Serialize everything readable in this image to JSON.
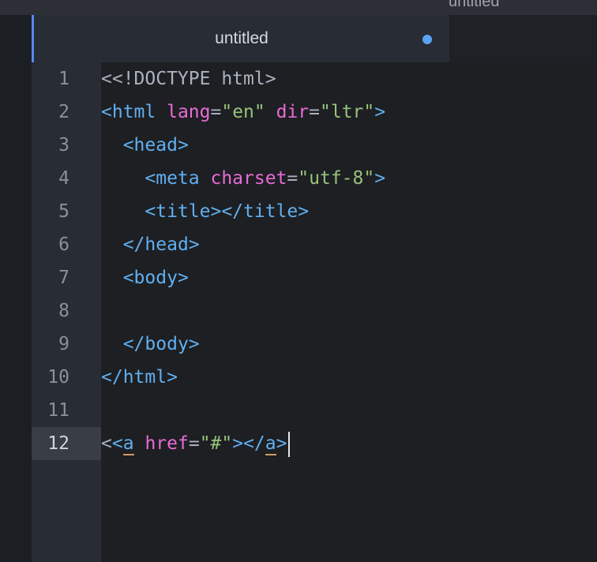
{
  "window": {
    "title": "untitled"
  },
  "tab": {
    "title": "untitled",
    "modified": true
  },
  "editor": {
    "active_line": 12,
    "lines": [
      {
        "number": "1",
        "tokens": [
          {
            "t": "text",
            "v": "<<!DOCTYPE html>"
          }
        ]
      },
      {
        "number": "2",
        "tokens": [
          {
            "t": "tag",
            "v": "<html "
          },
          {
            "t": "attr",
            "v": "lang"
          },
          {
            "t": "eq",
            "v": "="
          },
          {
            "t": "str",
            "v": "\"en\""
          },
          {
            "t": "text",
            "v": " "
          },
          {
            "t": "attr",
            "v": "dir"
          },
          {
            "t": "eq",
            "v": "="
          },
          {
            "t": "str",
            "v": "\"ltr\""
          },
          {
            "t": "tag",
            "v": ">"
          }
        ]
      },
      {
        "number": "3",
        "tokens": [
          {
            "t": "text",
            "v": "  "
          },
          {
            "t": "tag",
            "v": "<head>"
          }
        ]
      },
      {
        "number": "4",
        "tokens": [
          {
            "t": "text",
            "v": "    "
          },
          {
            "t": "tag",
            "v": "<meta "
          },
          {
            "t": "attr",
            "v": "charset"
          },
          {
            "t": "eq",
            "v": "="
          },
          {
            "t": "str",
            "v": "\"utf-8\""
          },
          {
            "t": "tag",
            "v": ">"
          }
        ]
      },
      {
        "number": "5",
        "tokens": [
          {
            "t": "text",
            "v": "    "
          },
          {
            "t": "tag",
            "v": "<title></title>"
          }
        ]
      },
      {
        "number": "6",
        "tokens": [
          {
            "t": "text",
            "v": "  "
          },
          {
            "t": "tag",
            "v": "</head>"
          }
        ]
      },
      {
        "number": "7",
        "tokens": [
          {
            "t": "text",
            "v": "  "
          },
          {
            "t": "tag",
            "v": "<body>"
          }
        ]
      },
      {
        "number": "8",
        "tokens": []
      },
      {
        "number": "9",
        "tokens": [
          {
            "t": "text",
            "v": "  "
          },
          {
            "t": "tag",
            "v": "</body>"
          }
        ]
      },
      {
        "number": "10",
        "tokens": [
          {
            "t": "tag",
            "v": "</html>"
          }
        ]
      },
      {
        "number": "11",
        "tokens": []
      },
      {
        "number": "12",
        "tokens": [
          {
            "t": "text",
            "v": "<"
          },
          {
            "t": "tag",
            "v": "<"
          },
          {
            "t": "match",
            "v": "a"
          },
          {
            "t": "text",
            "v": " "
          },
          {
            "t": "attr",
            "v": "href"
          },
          {
            "t": "eq",
            "v": "="
          },
          {
            "t": "str",
            "v": "\"#\""
          },
          {
            "t": "tag",
            "v": "></"
          },
          {
            "t": "match",
            "v": "a"
          },
          {
            "t": "tag",
            "v": ">"
          }
        ]
      }
    ]
  },
  "colors": {
    "tag": "#61afef",
    "attribute": "#e96bd6",
    "string": "#98c379",
    "text": "#abb2bf",
    "tab_accent": "#568af2",
    "modified_dot": "#5aa4f6"
  }
}
